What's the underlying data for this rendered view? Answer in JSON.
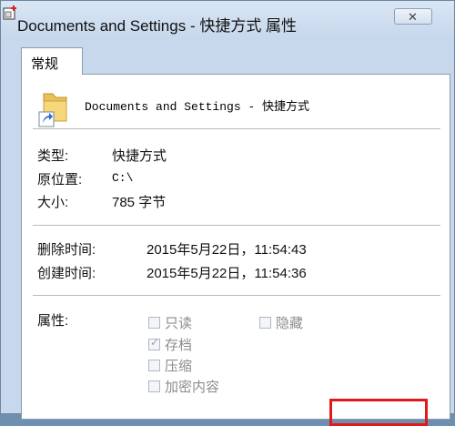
{
  "window": {
    "title": "Documents and Settings - 快捷方式 属性",
    "close_symbol": "✕"
  },
  "tabs": [
    {
      "label": "常规"
    }
  ],
  "general": {
    "name": "Documents and Settings - 快捷方式",
    "icon": "folder-shortcut-icon",
    "type_label": "类型:",
    "type_value": "快捷方式",
    "location_label": "原位置:",
    "location_value": "C:\\",
    "size_label": "大小:",
    "size_value": "785 字节",
    "deleted_label": "删除时间:",
    "deleted_value": "2015年5月22日，11:54:43",
    "created_label": "创建时间:",
    "created_value": "2015年5月22日，11:54:36",
    "attributes_label": "属性:",
    "attributes": [
      {
        "label": "只读",
        "checked": false
      },
      {
        "label": "存档",
        "checked": true
      },
      {
        "label": "压缩",
        "checked": false
      },
      {
        "label": "加密内容",
        "checked": false
      },
      {
        "label": "隐藏",
        "checked": false
      }
    ]
  },
  "colors": {
    "highlight_box": "#e01a1a",
    "panel_bg": "#ffffff"
  }
}
